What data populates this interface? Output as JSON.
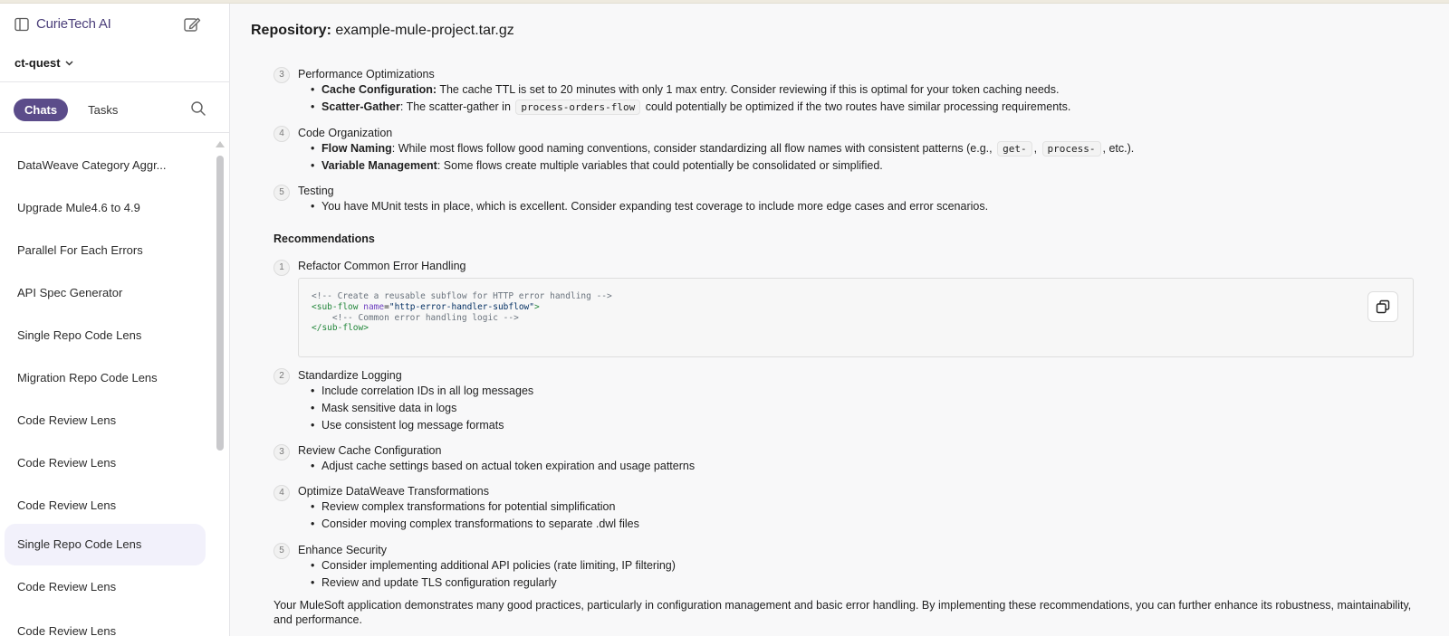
{
  "app": {
    "brand": "CurieTech AI",
    "org": "ct-quest",
    "accent": "#5b4c8a"
  },
  "sidebar": {
    "tabs": [
      {
        "label": "Chats",
        "active": true
      },
      {
        "label": "Tasks",
        "active": false
      }
    ],
    "chats": [
      {
        "label": "DataWeave Category Aggr..."
      },
      {
        "label": "Upgrade Mule4.6 to 4.9"
      },
      {
        "label": "Parallel For Each Errors"
      },
      {
        "label": "API Spec Generator"
      },
      {
        "label": "Single Repo Code Lens"
      },
      {
        "label": "Migration Repo Code Lens"
      },
      {
        "label": "Code Review Lens"
      },
      {
        "label": "Code Review Lens"
      },
      {
        "label": "Code Review Lens"
      },
      {
        "label": "Single Repo Code Lens",
        "active": true
      },
      {
        "label": "Code Review Lens"
      },
      {
        "label": "Code Review Lens"
      }
    ]
  },
  "main": {
    "repo_label": "Repository:",
    "repo_name": "example-mule-project.tar.gz",
    "sections": [
      {
        "num": "3",
        "title": "Performance Optimizations",
        "items": [
          {
            "bold": "Cache Configuration:",
            "text": " The cache TTL is set to 20 minutes with only 1 max entry. Consider reviewing if this is optimal for your token caching needs."
          },
          {
            "bold": "Scatter-Gather",
            "text": ": The scatter-gather in ",
            "code": "process-orders-flow",
            "after": " could potentially be optimized if the two routes have similar processing requirements."
          }
        ]
      },
      {
        "num": "4",
        "title": "Code Organization",
        "items": [
          {
            "bold": "Flow Naming",
            "text": ": While most flows follow good naming conventions, consider standardizing all flow names with consistent patterns (e.g., ",
            "code": "get-",
            "mid": ", ",
            "code2": "process-",
            "after": ", etc.)."
          },
          {
            "bold": "Variable Management",
            "text": ": Some flows create multiple variables that could potentially be consolidated or simplified."
          }
        ]
      },
      {
        "num": "5",
        "title": "Testing",
        "items": [
          {
            "text": "You have MUnit tests in place, which is excellent. Consider expanding test coverage to include more edge cases and error scenarios."
          }
        ]
      }
    ],
    "recommendations_heading": "Recommendations",
    "recommendations": [
      {
        "num": "1",
        "title": "Refactor Common Error Handling"
      },
      {
        "num": "2",
        "title": "Standardize Logging",
        "items": [
          "Include correlation IDs in all log messages",
          "Mask sensitive data in logs",
          "Use consistent log message formats"
        ]
      },
      {
        "num": "3",
        "title": "Review Cache Configuration",
        "items": [
          "Adjust cache settings based on actual token expiration and usage patterns"
        ]
      },
      {
        "num": "4",
        "title": "Optimize DataWeave Transformations",
        "items": [
          "Review complex transformations for potential simplification",
          "Consider moving complex transformations to separate .dwl files"
        ]
      },
      {
        "num": "5",
        "title": "Enhance Security",
        "items": [
          "Consider implementing additional API policies (rate limiting, IP filtering)",
          "Review and update TLS configuration regularly"
        ]
      }
    ],
    "code": {
      "comment1": "<!-- Create a reusable subflow for HTTP error handling -->",
      "open_tag": "<sub-flow",
      "attr": "name",
      "eq": "=",
      "val": "\"http-error-handler-subflow\"",
      "close_bracket": ">",
      "comment2": "<!-- Common error handling logic -->",
      "close_tag": "</sub-flow>"
    },
    "summary": "Your MuleSoft application demonstrates many good practices, particularly in configuration management and basic error handling. By implementing these recommendations, you can further enhance its robustness, maintainability, and performance."
  }
}
